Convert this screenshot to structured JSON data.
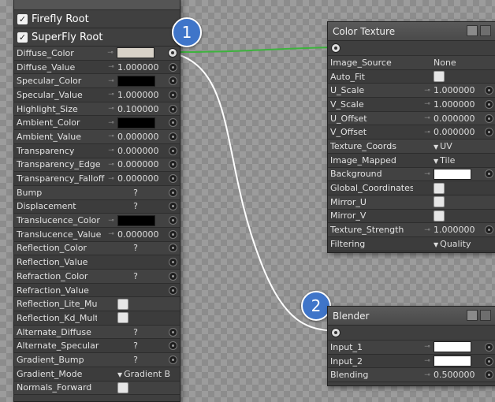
{
  "firefly_panel": {
    "roots": [
      {
        "label": "Firefly Root"
      },
      {
        "label": "SuperFly Root"
      }
    ],
    "rows": [
      {
        "label": "Diffuse_Color",
        "link": true,
        "kind": "swatch",
        "color": "#d8d2c8",
        "out": true
      },
      {
        "label": "Diffuse_Value",
        "link": true,
        "kind": "num",
        "value": "1.000000"
      },
      {
        "label": "Specular_Color",
        "link": true,
        "kind": "swatch",
        "color": "#000000"
      },
      {
        "label": "Specular_Value",
        "link": true,
        "kind": "num",
        "value": "1.000000"
      },
      {
        "label": "Highlight_Size",
        "link": true,
        "kind": "num",
        "value": "0.100000"
      },
      {
        "label": "Ambient_Color",
        "link": true,
        "kind": "swatch",
        "color": "#000000"
      },
      {
        "label": "Ambient_Value",
        "link": true,
        "kind": "num",
        "value": "0.000000"
      },
      {
        "label": "Transparency",
        "link": true,
        "kind": "num",
        "value": "0.000000"
      },
      {
        "label": "Transparency_Edge",
        "link": true,
        "kind": "num",
        "value": "0.000000"
      },
      {
        "label": "Transparency_Falloff",
        "link": true,
        "kind": "num",
        "value": "0.000000"
      },
      {
        "label": "Bump",
        "link": false,
        "kind": "q",
        "value": "?"
      },
      {
        "label": "Displacement",
        "link": false,
        "kind": "q",
        "value": "?"
      },
      {
        "label": "Translucence_Color",
        "link": true,
        "kind": "swatch",
        "color": "#000000"
      },
      {
        "label": "Translucence_Value",
        "link": true,
        "kind": "num",
        "value": "0.000000"
      },
      {
        "label": "Reflection_Color",
        "link": false,
        "kind": "q",
        "value": "?"
      },
      {
        "label": "Reflection_Value",
        "link": false,
        "kind": "none"
      },
      {
        "label": "Refraction_Color",
        "link": false,
        "kind": "q",
        "value": "?"
      },
      {
        "label": "Refraction_Value",
        "link": false,
        "kind": "none"
      },
      {
        "label": "Reflection_Lite_Mult",
        "link": false,
        "kind": "check",
        "noport": true
      },
      {
        "label": "Reflection_Kd_Mult",
        "link": false,
        "kind": "check",
        "noport": true
      },
      {
        "label": "Alternate_Diffuse",
        "link": false,
        "kind": "q",
        "value": "?"
      },
      {
        "label": "Alternate_Specular",
        "link": false,
        "kind": "q",
        "value": "?"
      },
      {
        "label": "Gradient_Bump",
        "link": false,
        "kind": "q",
        "value": "?"
      },
      {
        "label": "Gradient_Mode",
        "link": false,
        "kind": "drop",
        "value": "Gradient B",
        "noport": true
      },
      {
        "label": "Normals_Forward",
        "link": false,
        "kind": "check",
        "noport": true
      }
    ]
  },
  "color_texture": {
    "title": "Color Texture",
    "badge": "",
    "rows": [
      {
        "label": "Image_Source",
        "link": false,
        "kind": "text",
        "value": "None",
        "noport": true
      },
      {
        "label": "Auto_Fit",
        "link": false,
        "kind": "check",
        "noport": true
      },
      {
        "label": "U_Scale",
        "link": true,
        "kind": "num",
        "value": "1.000000"
      },
      {
        "label": "V_Scale",
        "link": true,
        "kind": "num",
        "value": "1.000000"
      },
      {
        "label": "U_Offset",
        "link": true,
        "kind": "num",
        "value": "0.000000"
      },
      {
        "label": "V_Offset",
        "link": true,
        "kind": "num",
        "value": "0.000000"
      },
      {
        "label": "Texture_Coords",
        "link": false,
        "kind": "drop",
        "value": "UV",
        "noport": true
      },
      {
        "label": "Image_Mapped",
        "link": false,
        "kind": "drop",
        "value": "Tile",
        "noport": true
      },
      {
        "label": "Background",
        "link": true,
        "kind": "swatch",
        "color": "#ffffff"
      },
      {
        "label": "Global_Coordinates",
        "link": false,
        "kind": "check",
        "noport": true
      },
      {
        "label": "Mirror_U",
        "link": false,
        "kind": "check",
        "noport": true
      },
      {
        "label": "Mirror_V",
        "link": false,
        "kind": "check",
        "noport": true
      },
      {
        "label": "Texture_Strength",
        "link": true,
        "kind": "num",
        "value": "1.000000"
      },
      {
        "label": "Filtering",
        "link": false,
        "kind": "drop",
        "value": "Quality",
        "noport": true
      }
    ]
  },
  "blender": {
    "title": "Blender",
    "rows": [
      {
        "label": "Input_1",
        "link": true,
        "kind": "swatch",
        "color": "#ffffff"
      },
      {
        "label": "Input_2",
        "link": true,
        "kind": "swatch",
        "color": "#ffffff"
      },
      {
        "label": "Blending",
        "link": true,
        "kind": "num",
        "value": "0.500000"
      }
    ]
  },
  "badges": {
    "one": "1",
    "two": "2"
  },
  "wire_colors": {
    "green": "#3db33d",
    "white": "#ffffff"
  }
}
